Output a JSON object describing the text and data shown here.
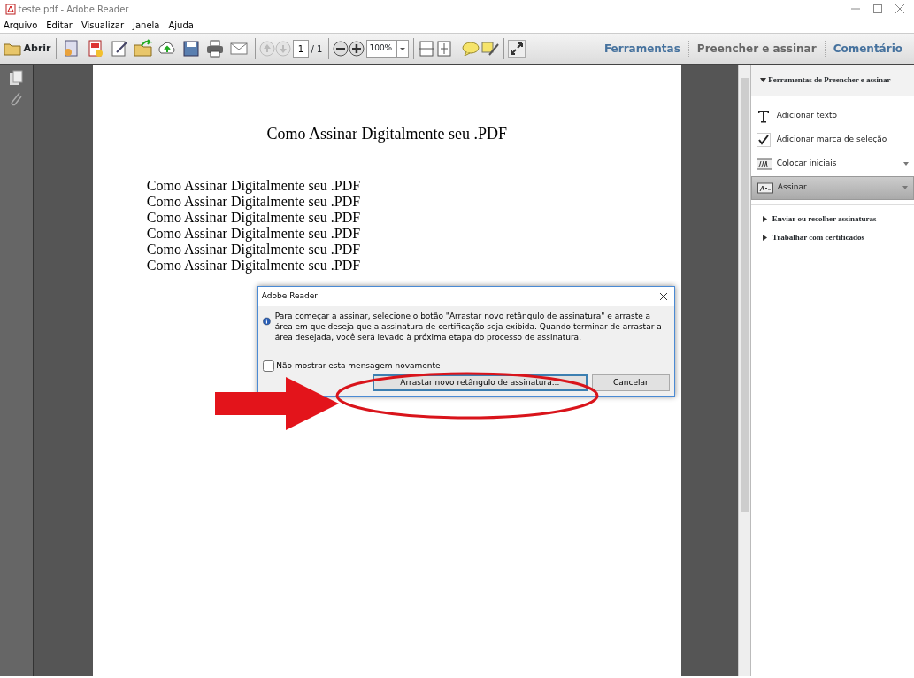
{
  "window": {
    "title": "teste.pdf - Adobe Reader"
  },
  "menu": [
    "Arquivo",
    "Editar",
    "Visualizar",
    "Janela",
    "Ajuda"
  ],
  "toolbar": {
    "open_label": "Abrir",
    "page": "1",
    "page_total": "/ 1",
    "zoom": "100%"
  },
  "tabs": [
    {
      "label": "Ferramentas",
      "selected": false
    },
    {
      "label": "Preencher e assinar",
      "selected": true
    },
    {
      "label": "Comentário",
      "selected": false
    }
  ],
  "document": {
    "heading": "Como Assinar Digitalmente seu .PDF",
    "lines": [
      "Como Assinar Digitalmente seu .PDF",
      "Como Assinar Digitalmente seu .PDF",
      "Como Assinar Digitalmente seu .PDF",
      "Como Assinar Digitalmente seu .PDF",
      "Como Assinar Digitalmente seu .PDF",
      "Como Assinar Digitalmente seu .PDF"
    ]
  },
  "panel": {
    "section": "Ferramentas de Preencher e assinar",
    "expanded": true,
    "tools": [
      {
        "label": "Adicionar texto",
        "kind": "text",
        "selected": false
      },
      {
        "label": "Adicionar marca de seleção",
        "kind": "check",
        "selected": false
      },
      {
        "label": "Colocar iniciais",
        "kind": "initials",
        "selected": false
      },
      {
        "label": "Assinar",
        "kind": "sign",
        "selected": true
      }
    ],
    "sections": [
      {
        "label": "Enviar ou recolher assinaturas",
        "expanded": false
      },
      {
        "label": "Trabalhar com certificados",
        "expanded": false
      }
    ]
  },
  "dialog": {
    "title": "Adobe Reader",
    "message": "Para começar a assinar, selecione o botão \"Arrastar novo retângulo de assinatura\" e arraste a área em que deseja que a assinatura de certificação seja exibida. Quando terminar de arrastar a área desejada, você será levado à próxima etapa do processo de assinatura.",
    "checkbox": {
      "label": "Não mostrar esta mensagem novamente",
      "checked": false
    },
    "buttons": [
      {
        "label": "Arrastar novo retângulo de assinatura...",
        "selected": true
      },
      {
        "label": "Cancelar",
        "selected": false
      }
    ]
  }
}
